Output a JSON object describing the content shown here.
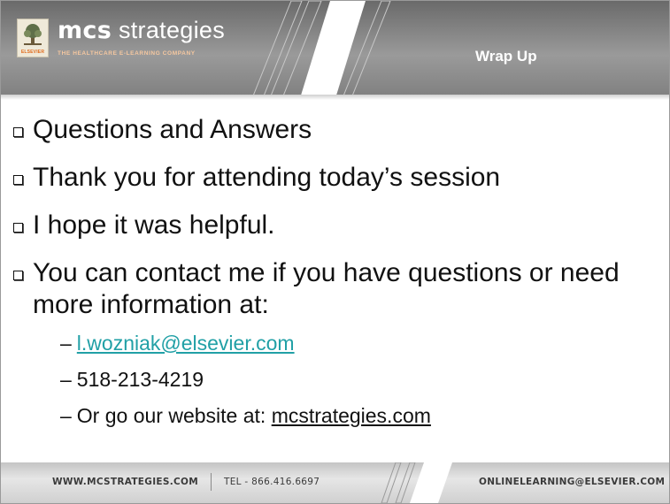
{
  "header": {
    "logo_caption": "ELSEVIER",
    "brand_mark": "mcs",
    "brand_word": "strategies",
    "tagline": "THE HEALTHCARE E-LEARNING COMPANY",
    "section_title": "Wrap Up"
  },
  "bullets": [
    {
      "text": "Questions and Answers"
    },
    {
      "text": "Thank you for attending today’s session"
    },
    {
      "text": "I hope it was helpful."
    },
    {
      "text": "You can contact me if you have questions or need more information at:"
    }
  ],
  "contacts": {
    "email": "l.wozniak@elsevier.com",
    "phone": "518-213-4219",
    "website_prefix": "Or go our website at: ",
    "website_link": "mcstrategies.com"
  },
  "footer": {
    "website": "WWW.MCSTRATEGIES.COM",
    "tel": "TEL - 866.416.6697",
    "email": "ONLINELEARNING@ELSEVIER.COM"
  },
  "colors": {
    "link_teal": "#21a0a6",
    "header_gray": "#8c8c8c",
    "accent_orange": "#e06a1a"
  }
}
